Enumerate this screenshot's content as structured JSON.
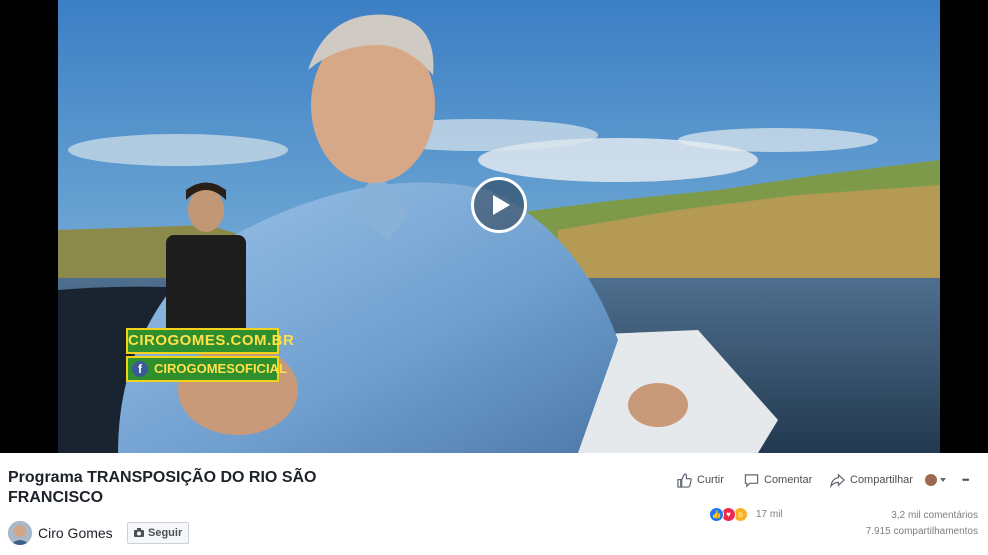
{
  "overlay": {
    "site": "CIROGOMES.COM.BR",
    "social": "CIROGOMESOFICIAL"
  },
  "video": {
    "title": "Programa TRANSPOSIÇÃO DO RIO SÃO FRANCISCO"
  },
  "channel": {
    "name": "Ciro Gomes",
    "follow_label": "Seguir"
  },
  "actions": {
    "like_label": "Curtir",
    "comment_label": "Comentar",
    "share_label": "Compartilhar",
    "more_label": "•••"
  },
  "stats": {
    "reactions_count": "17 mil",
    "comments": "3,2 mil comentários",
    "shares": "7.915 compartilhamentos"
  },
  "icons": {
    "play": "play-icon",
    "like": "thumbs-up-icon",
    "comment": "speech-bubble-icon",
    "share": "share-arrow-icon",
    "more": "ellipsis-icon"
  },
  "colors": {
    "facebook_blue": "#3b5998",
    "overlay_green": "#2f8f2d",
    "overlay_yellow": "#ffe14a"
  }
}
